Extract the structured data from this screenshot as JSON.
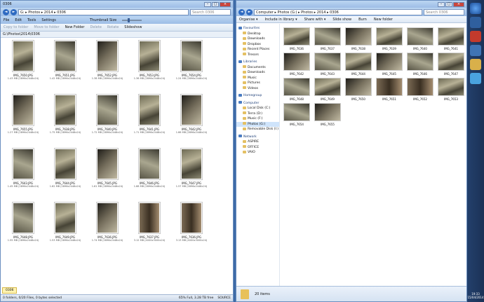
{
  "left": {
    "title": "0306",
    "address": "G: ▸ Photos ▸ 2014 ▸ 0306",
    "search": "Search 0306",
    "menu": [
      "File",
      "Edit",
      "Tools",
      "Settings"
    ],
    "toolbar": [
      "Copy to folder",
      "Move to folder",
      "Rename",
      "New Folder",
      "Delete",
      "Rotate",
      "Slideshow"
    ],
    "thumb_label": "Thumbnail Size",
    "path": "G:\\Photos\\2014\\0306",
    "files": [
      {
        "n": "IMG_7650.JPG",
        "s": "1.43 MB (2896x2448x24)"
      },
      {
        "n": "IMG_7651.JPG",
        "s": "1.42 MB (2896x2448x24)"
      },
      {
        "n": "IMG_7652.JPG",
        "s": "1.38 MB (2896x2448x24)"
      },
      {
        "n": "IMG_7653.JPG",
        "s": "1.36 MB (2896x2448x24)"
      },
      {
        "n": "IMG_7654.JPG",
        "s": "1.24 MB (2896x2448x24)"
      },
      {
        "n": "IMG_7655.JPG",
        "s": "1.27 MB (2896x2448x24)"
      },
      {
        "n": "IMG_7638.JPG",
        "s": "1.75 MB (2896x2448x24)"
      },
      {
        "n": "IMG_7640.JPG",
        "s": "1.72 MB (2896x2448x24)"
      },
      {
        "n": "IMG_7641.JPG",
        "s": "1.71 MB (2896x2448x24)"
      },
      {
        "n": "IMG_7642.JPG",
        "s": "1.66 MB (2896x2448x24)"
      },
      {
        "n": "IMG_7643.JPG",
        "s": "1.45 MB (2896x2448x24)"
      },
      {
        "n": "IMG_7644.JPG",
        "s": "1.62 MB (2896x2448x24)"
      },
      {
        "n": "IMG_7645.JPG",
        "s": "1.61 MB (2896x2448x24)"
      },
      {
        "n": "IMG_7646.JPG",
        "s": "1.68 MB (2896x2448x24)"
      },
      {
        "n": "IMG_7647.JPG",
        "s": "1.57 MB (2896x2448x24)"
      },
      {
        "n": "IMG_7648.JPG",
        "s": "1.55 MB (2896x2448x24)"
      },
      {
        "n": "IMG_7649.JPG",
        "s": "1.53 MB (2896x2448x24)"
      },
      {
        "n": "IMG_7636.JPG",
        "s": "1.74 MB (2896x2448x24)"
      },
      {
        "n": "IMG_7637.JPG",
        "s": "3.12 MB (4000x3000x24)"
      },
      {
        "n": "IMG_7636.JPG",
        "s": "3.13 MB (4000x3000x24)"
      }
    ],
    "tab": "0306",
    "status": "0 folders, 0/20 Files, 0 bytes selected",
    "status_right": "65% Full, 3.28 TB free",
    "status_src": "SOURCE"
  },
  "right": {
    "address": "Computer ▸ Photos (G:) ▸ Photos ▸ 2014 ▸ 0306",
    "search": "Search 0306",
    "toolbar": [
      "Organise ▾",
      "Include in library ▾",
      "Share with ▾",
      "Slide show",
      "Burn",
      "New folder"
    ],
    "nav": [
      {
        "t": "Favourites",
        "h": true
      },
      {
        "t": "Desktop"
      },
      {
        "t": "Downloads"
      },
      {
        "t": "Dropbox"
      },
      {
        "t": "Recent Places"
      },
      {
        "t": "Tresors"
      },
      {
        "t": "Libraries",
        "h": true
      },
      {
        "t": "Documents"
      },
      {
        "t": "Downloads"
      },
      {
        "t": "Music"
      },
      {
        "t": "Pictures"
      },
      {
        "t": "Videos"
      },
      {
        "t": "Homegroup",
        "h": true
      },
      {
        "t": "Computer",
        "h": true
      },
      {
        "t": "Local Disk (C:)"
      },
      {
        "t": "Terra (D:)"
      },
      {
        "t": "Music (F:)"
      },
      {
        "t": "Photos (G:)",
        "sel": true
      },
      {
        "t": "Removable Disk (I:)"
      },
      {
        "t": "Network",
        "h": true
      },
      {
        "t": "ASPIRE"
      },
      {
        "t": "OFFICE"
      },
      {
        "t": "VAIO"
      }
    ],
    "files": [
      "IMG_7636",
      "IMG_7637",
      "IMG_7638",
      "IMG_7639",
      "IMG_7640",
      "IMG_7641",
      "IMG_7642",
      "IMG_7643",
      "IMG_7644",
      "IMG_7645",
      "IMG_7646",
      "IMG_7647",
      "IMG_7648",
      "IMG_7649",
      "IMG_7650",
      "IMG_7651",
      "IMG_7652",
      "IMG_7653",
      "IMG_7654",
      "IMG_7655"
    ],
    "count": "20 items"
  },
  "clock": {
    "time": "19:33",
    "date": "15/04/2014"
  }
}
